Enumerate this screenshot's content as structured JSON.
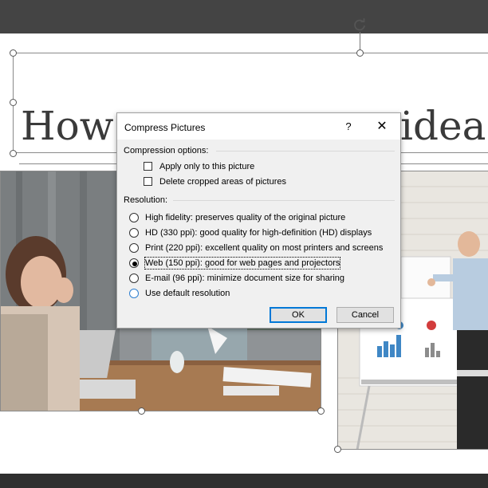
{
  "slide": {
    "title_visible_left": "How",
    "title_visible_right": "idea"
  },
  "dialog": {
    "title": "Compress Pictures",
    "help_label": "?",
    "close_label": "✕",
    "compression_group_label": "Compression options:",
    "compression_options": [
      {
        "label": "Apply only to this picture",
        "checked": false
      },
      {
        "label": "Delete cropped areas of pictures",
        "checked": false
      }
    ],
    "resolution_group_label": "Resolution:",
    "resolution_options": [
      {
        "label": "High fidelity: preserves quality of the original picture",
        "selected": false
      },
      {
        "label": "HD (330 ppi): good quality for high-definition (HD) displays",
        "selected": false
      },
      {
        "label": "Print (220 ppi): excellent quality on most printers and screens",
        "selected": false
      },
      {
        "label": "Web (150 ppi): good for web pages and projectors",
        "selected": true
      },
      {
        "label": "E-mail (96 ppi): minimize document size for sharing",
        "selected": false
      },
      {
        "label": "Use default resolution",
        "selected": false
      }
    ],
    "ok_label": "OK",
    "cancel_label": "Cancel"
  },
  "colors": {
    "accent": "#0078d7",
    "toolbar": "#444444"
  },
  "icons": {
    "rotate": "rotate-handle-icon",
    "close": "close-icon",
    "help": "help-icon"
  }
}
